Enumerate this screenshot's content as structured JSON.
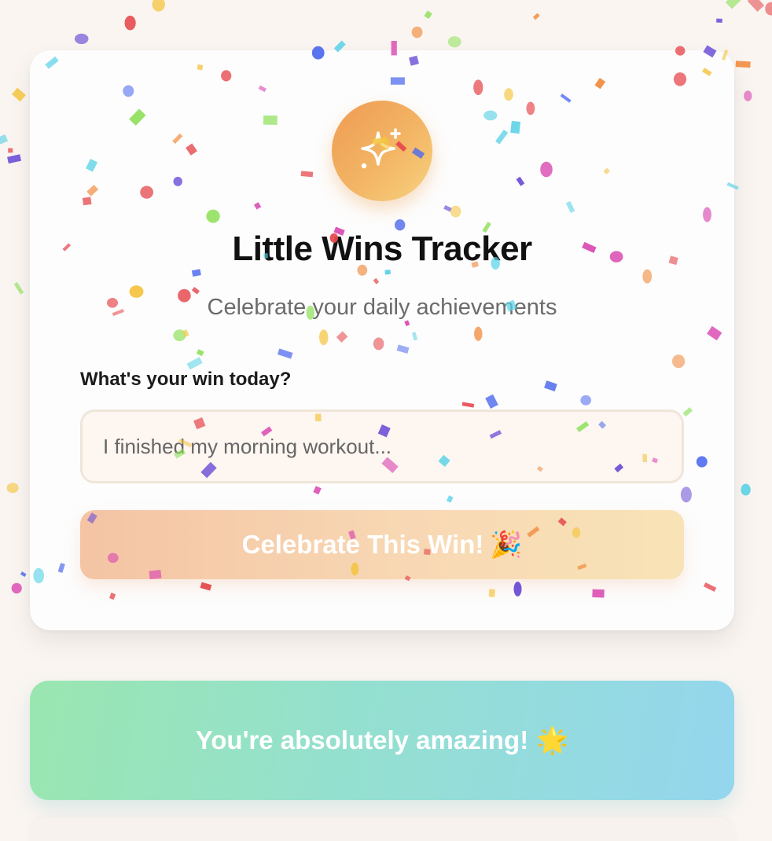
{
  "app": {
    "title": "Little Wins Tracker",
    "subtitle": "Celebrate your daily achievements",
    "logo_icon": "sparkles-icon"
  },
  "form": {
    "label": "What's your win today?",
    "placeholder": "I finished my morning workout...",
    "value": "",
    "button_label": "Celebrate This Win!",
    "button_emoji": "🎉"
  },
  "affirmation": {
    "text": "You're absolutely amazing!",
    "emoji": "🌟"
  },
  "colors": {
    "logo_start": "#ee9b52",
    "logo_end": "#f7d27e",
    "button_start": "#f4c4a4",
    "button_end": "#f8e3b6",
    "affirm_start": "#9ae6b0",
    "affirm_end": "#94d6ee",
    "confetti": [
      "#e5484d",
      "#4f6bed",
      "#8ee05a",
      "#f08a3c",
      "#d946b0",
      "#f4c542",
      "#6a4cd6",
      "#5ad2e6"
    ]
  }
}
